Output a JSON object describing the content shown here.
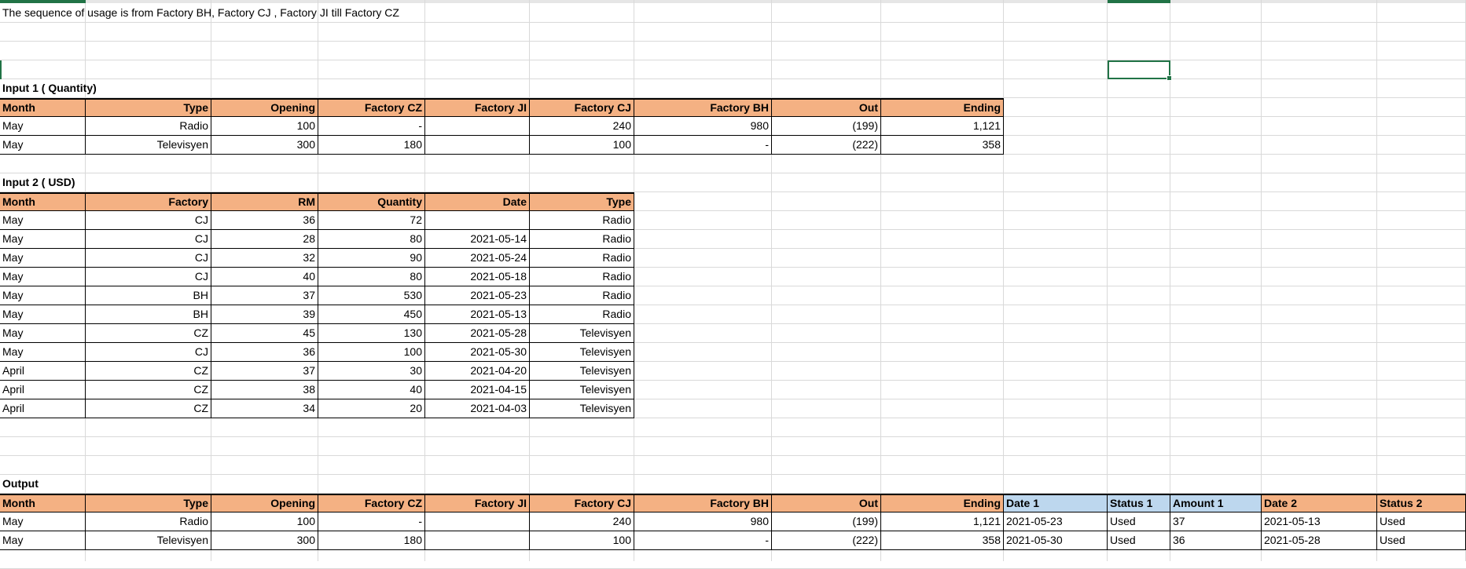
{
  "intro": "The sequence of usage is from Factory BH,  Factory CJ , Factory JI till Factory CZ",
  "input1": {
    "title": "Input 1 ( Quantity)",
    "headers": [
      "Month",
      "Type",
      "Opening",
      "Factory CZ",
      "Factory JI",
      "Factory CJ",
      "Factory BH",
      "Out",
      "Ending"
    ],
    "rows": [
      [
        "May",
        "Radio",
        "100",
        "-",
        "",
        "240",
        "980",
        "(199)",
        "1,121"
      ],
      [
        "May",
        "Televisyen",
        "300",
        "180",
        "",
        "100",
        "-",
        "(222)",
        "358"
      ]
    ]
  },
  "input2": {
    "title": "Input 2 ( USD)",
    "headers": [
      "Month",
      "Factory",
      "RM",
      "Quantity",
      "Date",
      "Type"
    ],
    "rows": [
      [
        "May",
        "CJ",
        "36",
        "72",
        "",
        "Radio"
      ],
      [
        "May",
        "CJ",
        "28",
        "80",
        "2021-05-14",
        "Radio"
      ],
      [
        "May",
        "CJ",
        "32",
        "90",
        "2021-05-24",
        "Radio"
      ],
      [
        "May",
        "CJ",
        "40",
        "80",
        "2021-05-18",
        "Radio"
      ],
      [
        "May",
        "BH",
        "37",
        "530",
        "2021-05-23",
        "Radio"
      ],
      [
        "May",
        "BH",
        "39",
        "450",
        "2021-05-13",
        "Radio"
      ],
      [
        "May",
        "CZ",
        "45",
        "130",
        "2021-05-28",
        "Televisyen"
      ],
      [
        "May",
        "CJ",
        "36",
        "100",
        "2021-05-30",
        "Televisyen"
      ],
      [
        "April",
        "CZ",
        "37",
        "30",
        "2021-04-20",
        "Televisyen"
      ],
      [
        "April",
        "CZ",
        "38",
        "40",
        "2021-04-15",
        "Televisyen"
      ],
      [
        "April",
        "CZ",
        "34",
        "20",
        "2021-04-03",
        "Televisyen"
      ]
    ]
  },
  "output": {
    "title": "Output",
    "headers": [
      "Month",
      "Type",
      "Opening",
      "Factory CZ",
      "Factory JI",
      "Factory CJ",
      "Factory BH",
      "Out",
      "Ending",
      "Date 1",
      "Status 1",
      "Amount 1",
      "Date 2",
      "Status 2"
    ],
    "rows": [
      [
        "May",
        "Radio",
        "100",
        "-",
        "",
        "240",
        "980",
        "(199)",
        "1,121",
        "2021-05-23",
        "Used",
        "37",
        "2021-05-13",
        "Used"
      ],
      [
        "May",
        "Televisyen",
        "300",
        "180",
        "",
        "100",
        "-",
        "(222)",
        "358",
        "2021-05-30",
        "Used",
        "36",
        "2021-05-28",
        "Used"
      ]
    ]
  },
  "colors": {
    "header": "#F4B183",
    "header_blue": "#BDD7EE",
    "selection": "#217346"
  }
}
